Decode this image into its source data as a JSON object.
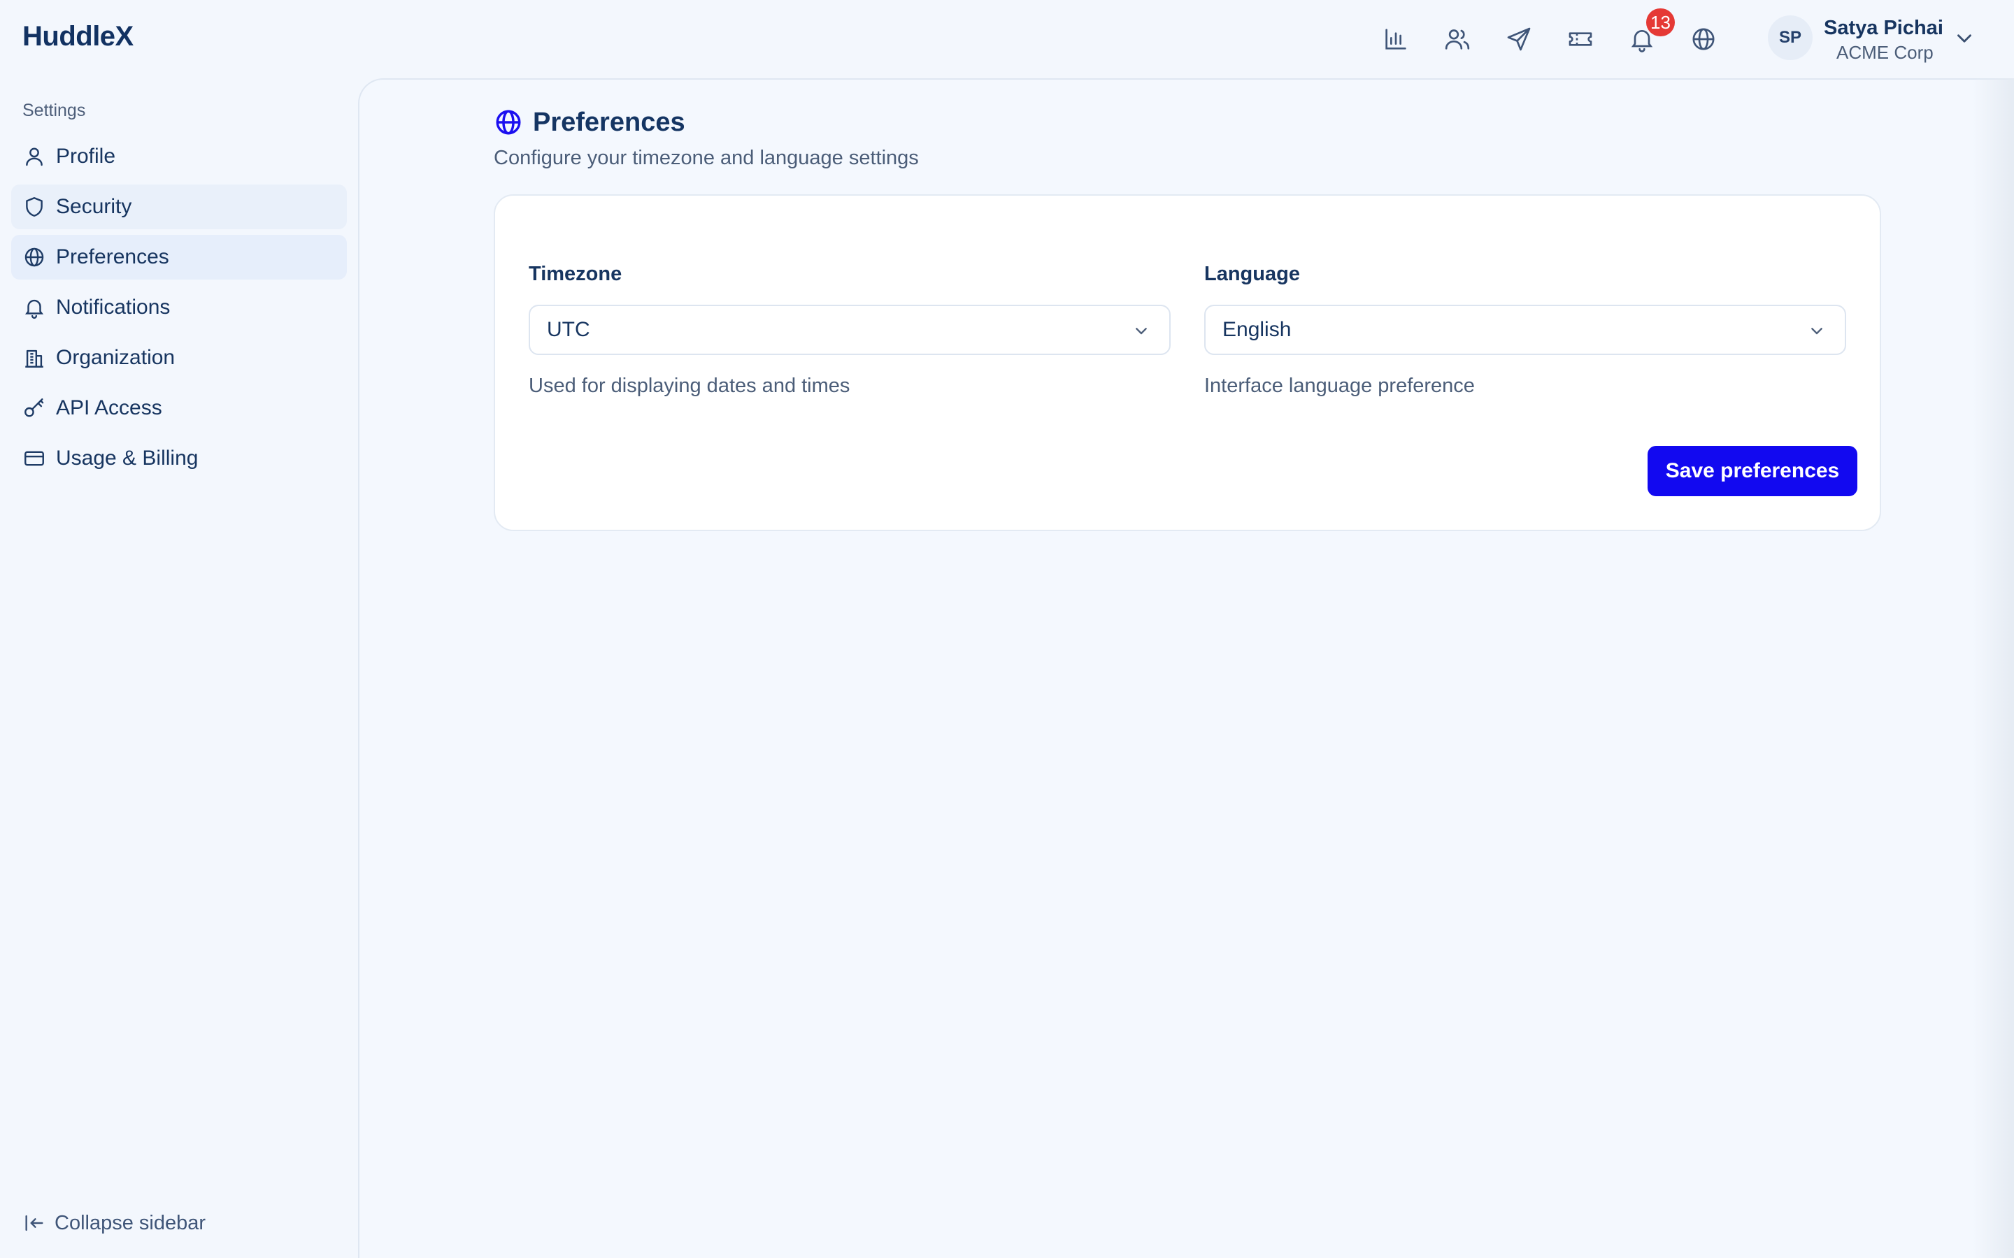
{
  "app": {
    "brand": "HuddleX"
  },
  "header": {
    "icons": [
      "bar-chart-icon",
      "users-icon",
      "send-icon",
      "ticket-icon",
      "bell-icon",
      "globe-icon"
    ],
    "notification_count": "13",
    "user": {
      "initials": "SP",
      "name": "Satya Pichai",
      "org": "ACME Corp"
    }
  },
  "sidebar": {
    "heading": "Settings",
    "items": [
      {
        "label": "Profile",
        "icon": "user-icon"
      },
      {
        "label": "Security",
        "icon": "shield-icon"
      },
      {
        "label": "Preferences",
        "icon": "globe-icon"
      },
      {
        "label": "Notifications",
        "icon": "bell-icon"
      },
      {
        "label": "Organization",
        "icon": "building-icon"
      },
      {
        "label": "API Access",
        "icon": "key-icon"
      },
      {
        "label": "Usage & Billing",
        "icon": "credit-card-icon"
      }
    ],
    "active_item": "Preferences",
    "collapse_label": "Collapse sidebar"
  },
  "main": {
    "title": "Preferences",
    "subtitle": "Configure your timezone and language settings",
    "form": {
      "timezone": {
        "label": "Timezone",
        "value": "UTC",
        "hint": "Used for displaying dates and times"
      },
      "language": {
        "label": "Language",
        "value": "English",
        "hint": "Interface language preference"
      },
      "save_label": "Save preferences"
    }
  },
  "colors": {
    "accent": "#1209f0",
    "brand_text": "#123262",
    "badge": "#e53935",
    "background": "#f3f7fd"
  }
}
